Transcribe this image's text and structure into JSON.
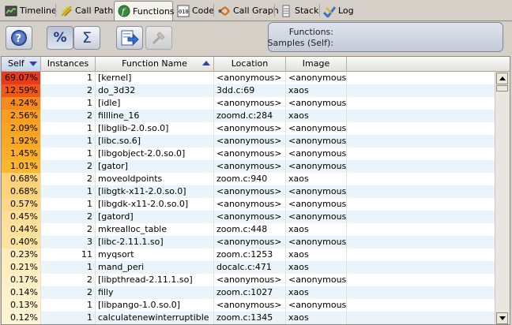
{
  "tabs": [
    {
      "label": "Timeline",
      "icon": "timeline-icon",
      "active": false
    },
    {
      "label": "Call Paths",
      "icon": "call-paths-icon",
      "active": false
    },
    {
      "label": "Functions",
      "icon": "functions-icon",
      "active": true
    },
    {
      "label": "Code",
      "icon": "code-icon",
      "active": false
    },
    {
      "label": "Call Graph",
      "icon": "call-graph-icon",
      "active": false
    },
    {
      "label": "Stack",
      "icon": "stack-icon",
      "active": false
    },
    {
      "label": "Log",
      "icon": "log-icon",
      "active": false
    }
  ],
  "toolbar": {
    "help_icon": "help-icon",
    "percent_label": "%",
    "sigma_label": "Σ",
    "export_icon": "export-icon",
    "tools_icon": "tools-icon"
  },
  "info": {
    "functions_label": "Functions:",
    "samples_label": "Samples (Self):"
  },
  "table": {
    "columns": [
      "Self",
      "Instances",
      "Function Name",
      "Location",
      "Image"
    ],
    "rows": [
      {
        "self": "69.07%",
        "self_color": "#e83a1c",
        "instances": "1",
        "function": "[kernel]",
        "location": "<anonymous>",
        "image": "<anonymous>"
      },
      {
        "self": "12.59%",
        "self_color": "#f2571a",
        "instances": "2",
        "function": "do_3d32",
        "location": "3dd.c:69",
        "image": "xaos"
      },
      {
        "self": "4.24%",
        "self_color": "#f68a1e",
        "instances": "1",
        "function": "[idle]",
        "location": "<anonymous>",
        "image": "<anonymous>"
      },
      {
        "self": "2.56%",
        "self_color": "#f89e20",
        "instances": "2",
        "function": "fillline_16",
        "location": "zoomd.c:284",
        "image": "xaos"
      },
      {
        "self": "2.09%",
        "self_color": "#f9a524",
        "instances": "1",
        "function": "[libglib-2.0.so.0]",
        "location": "<anonymous>",
        "image": "<anonymous>"
      },
      {
        "self": "1.92%",
        "self_color": "#f9a826",
        "instances": "1",
        "function": "[libc.so.6]",
        "location": "<anonymous>",
        "image": "<anonymous>"
      },
      {
        "self": "1.45%",
        "self_color": "#faae2a",
        "instances": "1",
        "function": "[libgobject-2.0.so.0]",
        "location": "<anonymous>",
        "image": "<anonymous>"
      },
      {
        "self": "1.01%",
        "self_color": "#fbb630",
        "instances": "2",
        "function": "[gator]",
        "location": "<anonymous>",
        "image": "<anonymous>"
      },
      {
        "self": "0.68%",
        "self_color": "#fcd27a",
        "instances": "2",
        "function": "moveoldpoints",
        "location": "zoom.c:940",
        "image": "xaos"
      },
      {
        "self": "0.68%",
        "self_color": "#fcd27a",
        "instances": "1",
        "function": "[libgtk-x11-2.0.so.0]",
        "location": "<anonymous>",
        "image": "<anonymous>"
      },
      {
        "self": "0.57%",
        "self_color": "#fcd886",
        "instances": "1",
        "function": "[libgdk-x11-2.0.so.0]",
        "location": "<anonymous>",
        "image": "<anonymous>"
      },
      {
        "self": "0.45%",
        "self_color": "#fddf98",
        "instances": "2",
        "function": "[gatord]",
        "location": "<anonymous>",
        "image": "<anonymous>"
      },
      {
        "self": "0.44%",
        "self_color": "#fde09a",
        "instances": "2",
        "function": "mkrealloc_table",
        "location": "zoom.c:448",
        "image": "xaos"
      },
      {
        "self": "0.40%",
        "self_color": "#fde2a0",
        "instances": "3",
        "function": "[libc-2.11.1.so]",
        "location": "<anonymous>",
        "image": "<anonymous>"
      },
      {
        "self": "0.23%",
        "self_color": "#feecbc",
        "instances": "11",
        "function": "myqsort",
        "location": "zoom.c:1253",
        "image": "xaos"
      },
      {
        "self": "0.21%",
        "self_color": "#feedbf",
        "instances": "1",
        "function": "mand_peri",
        "location": "docalc.c:471",
        "image": "xaos"
      },
      {
        "self": "0.17%",
        "self_color": "#feefc6",
        "instances": "2",
        "function": "[libpthread-2.11.1.so]",
        "location": "<anonymous>",
        "image": "<anonymous>"
      },
      {
        "self": "0.14%",
        "self_color": "#fef1cc",
        "instances": "2",
        "function": "filly",
        "location": "zoom.c:1027",
        "image": "xaos"
      },
      {
        "self": "0.13%",
        "self_color": "#fef2cf",
        "instances": "1",
        "function": "[libpango-1.0.so.0]",
        "location": "<anonymous>",
        "image": "<anonymous>"
      },
      {
        "self": "0.12%",
        "self_color": "#fef3d2",
        "instances": "1",
        "function": "calculatenewinterruptible",
        "location": "zoom.c:1345",
        "image": "xaos"
      }
    ]
  }
}
